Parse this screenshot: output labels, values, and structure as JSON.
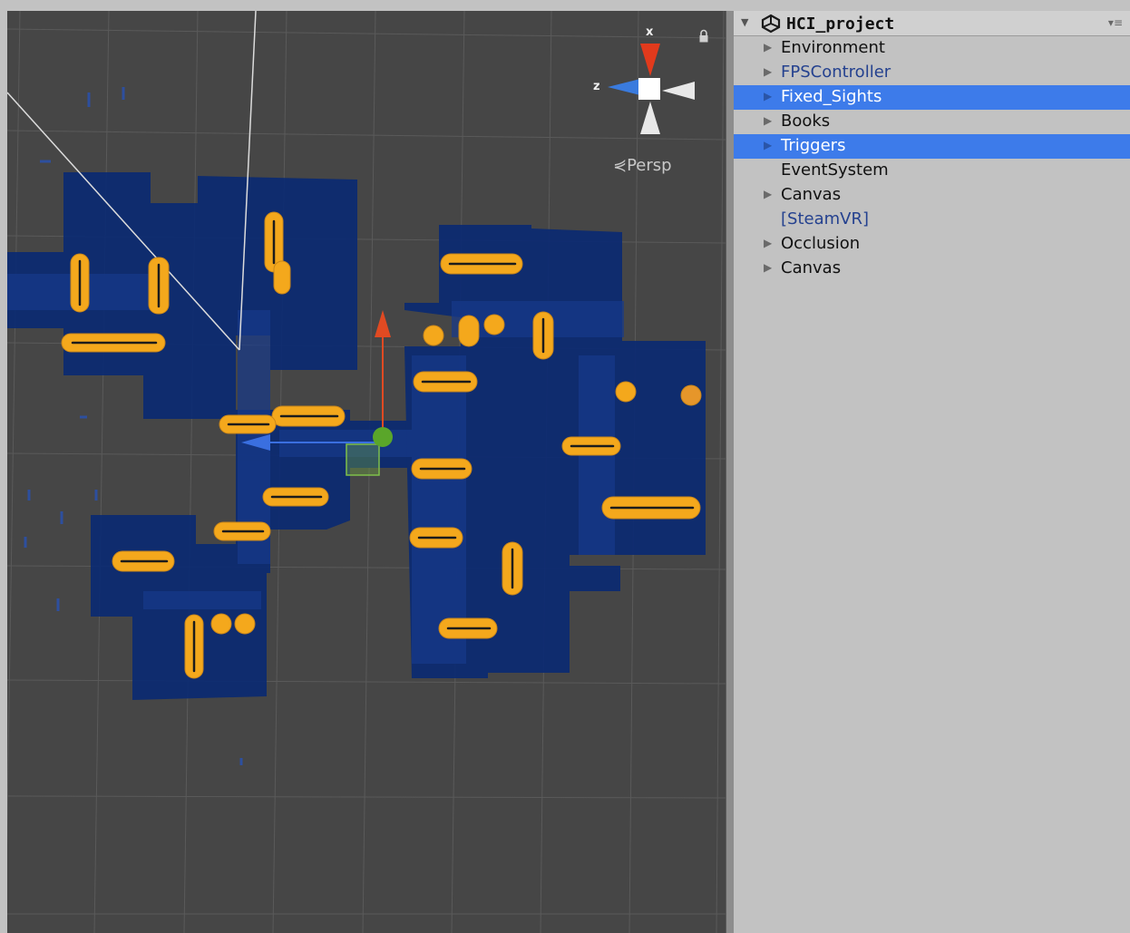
{
  "scene": {
    "view_mode": "Persp",
    "axis_x": "x",
    "axis_z": "z"
  },
  "hierarchy": {
    "title": "HCI_project",
    "items": [
      {
        "label": "Environment",
        "has_children": true,
        "selected": false,
        "prefab": false
      },
      {
        "label": "FPSController",
        "has_children": true,
        "selected": false,
        "prefab": true
      },
      {
        "label": "Fixed_Sights",
        "has_children": true,
        "selected": true,
        "prefab": false
      },
      {
        "label": "Books",
        "has_children": true,
        "selected": false,
        "prefab": false
      },
      {
        "label": "Triggers",
        "has_children": true,
        "selected": true,
        "prefab": false
      },
      {
        "label": "EventSystem",
        "has_children": false,
        "selected": false,
        "prefab": false
      },
      {
        "label": "Canvas",
        "has_children": true,
        "selected": false,
        "prefab": false
      },
      {
        "label": "[SteamVR]",
        "has_children": false,
        "selected": false,
        "prefab": true
      },
      {
        "label": "Occlusion",
        "has_children": true,
        "selected": false,
        "prefab": false
      },
      {
        "label": "Canvas",
        "has_children": true,
        "selected": false,
        "prefab": false
      }
    ]
  },
  "colors": {
    "scene_bg": "#464646",
    "floor": "#0b2a72",
    "highlight": "#f4a81c",
    "selection": "#3d7bea",
    "prefab_text": "#24418f"
  }
}
